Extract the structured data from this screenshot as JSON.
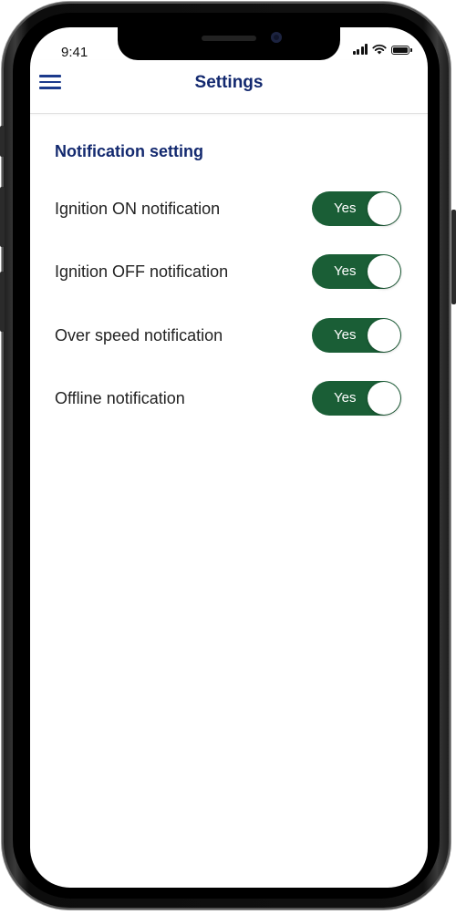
{
  "status_bar": {
    "time": "9:41",
    "signal_icon": "signal-bars-icon",
    "wifi_icon": "wifi-icon",
    "battery_icon": "battery-icon"
  },
  "header": {
    "menu_icon": "hamburger-menu-icon",
    "title": "Settings"
  },
  "section": {
    "title": "Notification setting"
  },
  "settings": [
    {
      "label": "Ignition ON notification",
      "toggle_label": "Yes",
      "enabled": true
    },
    {
      "label": "Ignition OFF notification",
      "toggle_label": "Yes",
      "enabled": true
    },
    {
      "label": "Over speed notification",
      "toggle_label": "Yes",
      "enabled": true
    },
    {
      "label": "Offline notification",
      "toggle_label": "Yes",
      "enabled": true
    }
  ],
  "colors": {
    "accent": "#13296f",
    "toggle_on": "#1a5e36",
    "menu_icon": "#1b3a8c"
  }
}
